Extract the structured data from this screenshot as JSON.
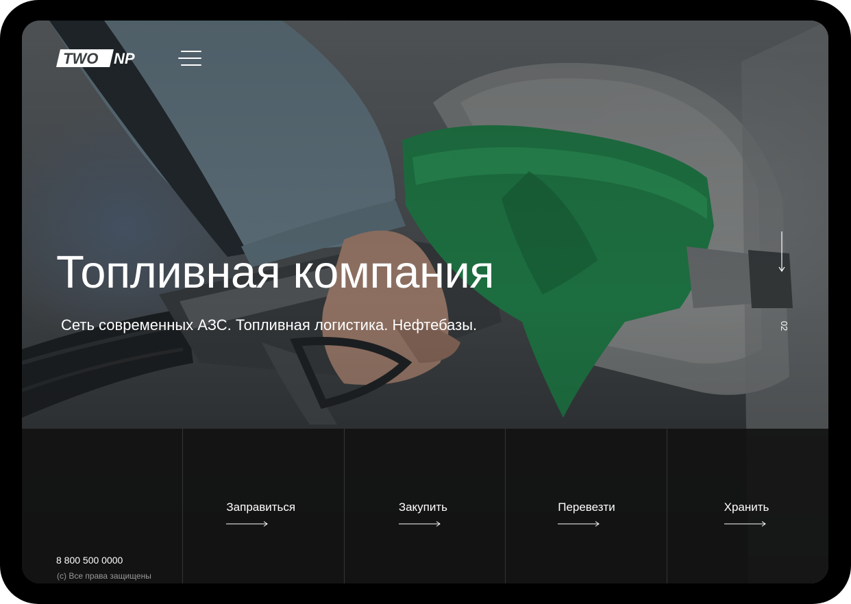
{
  "brand": {
    "logo_text_left": "TWO",
    "logo_text_right": "NP",
    "logo_color": "#ffffff"
  },
  "header": {
    "menu_icon": "hamburger-menu-icon"
  },
  "hero": {
    "title": "Топливная компания",
    "subtitle": "Сеть современных АЗС. Топливная логистика. Нефтебазы.",
    "slide_counter": "02",
    "scroll_icon": "arrow-down-icon",
    "background_image": "fuel-nozzle-photo"
  },
  "footer": {
    "phone": "8 800 500 0000",
    "copyright": "(c) Все права защищены",
    "services": [
      {
        "label": "Заправиться",
        "icon": "arrow-right-icon"
      },
      {
        "label": "Закупить",
        "icon": "arrow-right-icon"
      },
      {
        "label": "Перевезти",
        "icon": "arrow-right-icon"
      },
      {
        "label": "Хранить",
        "icon": "arrow-right-icon"
      }
    ]
  },
  "colors": {
    "device_frame": "#000000",
    "text": "#ffffff",
    "muted_text": "#9a9a9a",
    "nozzle_green": "#1f8a4c",
    "bottom_bar": "#121212"
  }
}
